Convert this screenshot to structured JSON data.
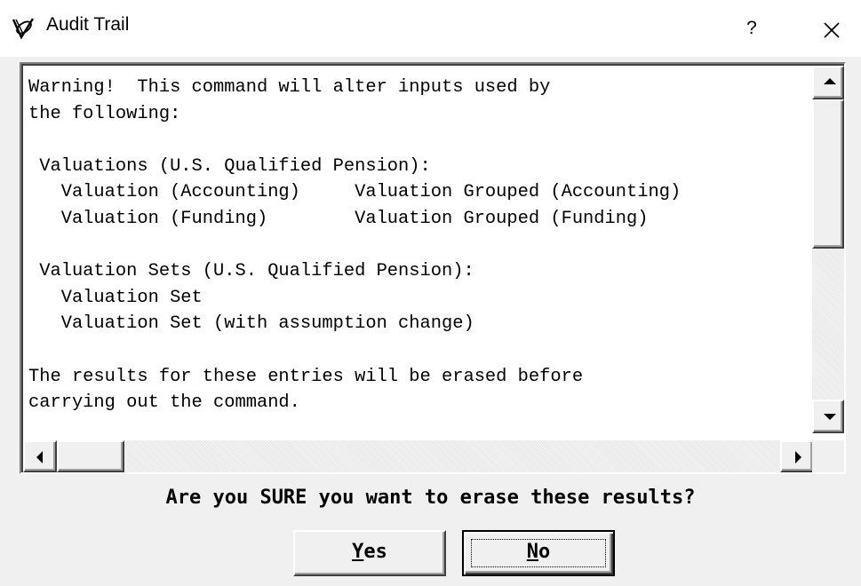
{
  "window": {
    "title": "Audit Trail",
    "help_label": "?",
    "icon": "app-logo-icon",
    "close_icon": "close-icon"
  },
  "message": {
    "lines": [
      "Warning!  This command will alter inputs used by",
      "the following:",
      "",
      " Valuations (U.S. Qualified Pension):",
      "   Valuation (Accounting)     Valuation Grouped (Accounting)",
      "   Valuation (Funding)        Valuation Grouped (Funding)",
      "",
      " Valuation Sets (U.S. Qualified Pension):",
      "   Valuation Set",
      "   Valuation Set (with assumption change)",
      "",
      "The results for these entries will be erased before",
      "carrying out the command."
    ]
  },
  "prompt": "Are you SURE you want to erase these results?",
  "buttons": {
    "yes": {
      "mnemonic": "Y",
      "rest": "es"
    },
    "no": {
      "mnemonic": "N",
      "rest": "o"
    }
  }
}
